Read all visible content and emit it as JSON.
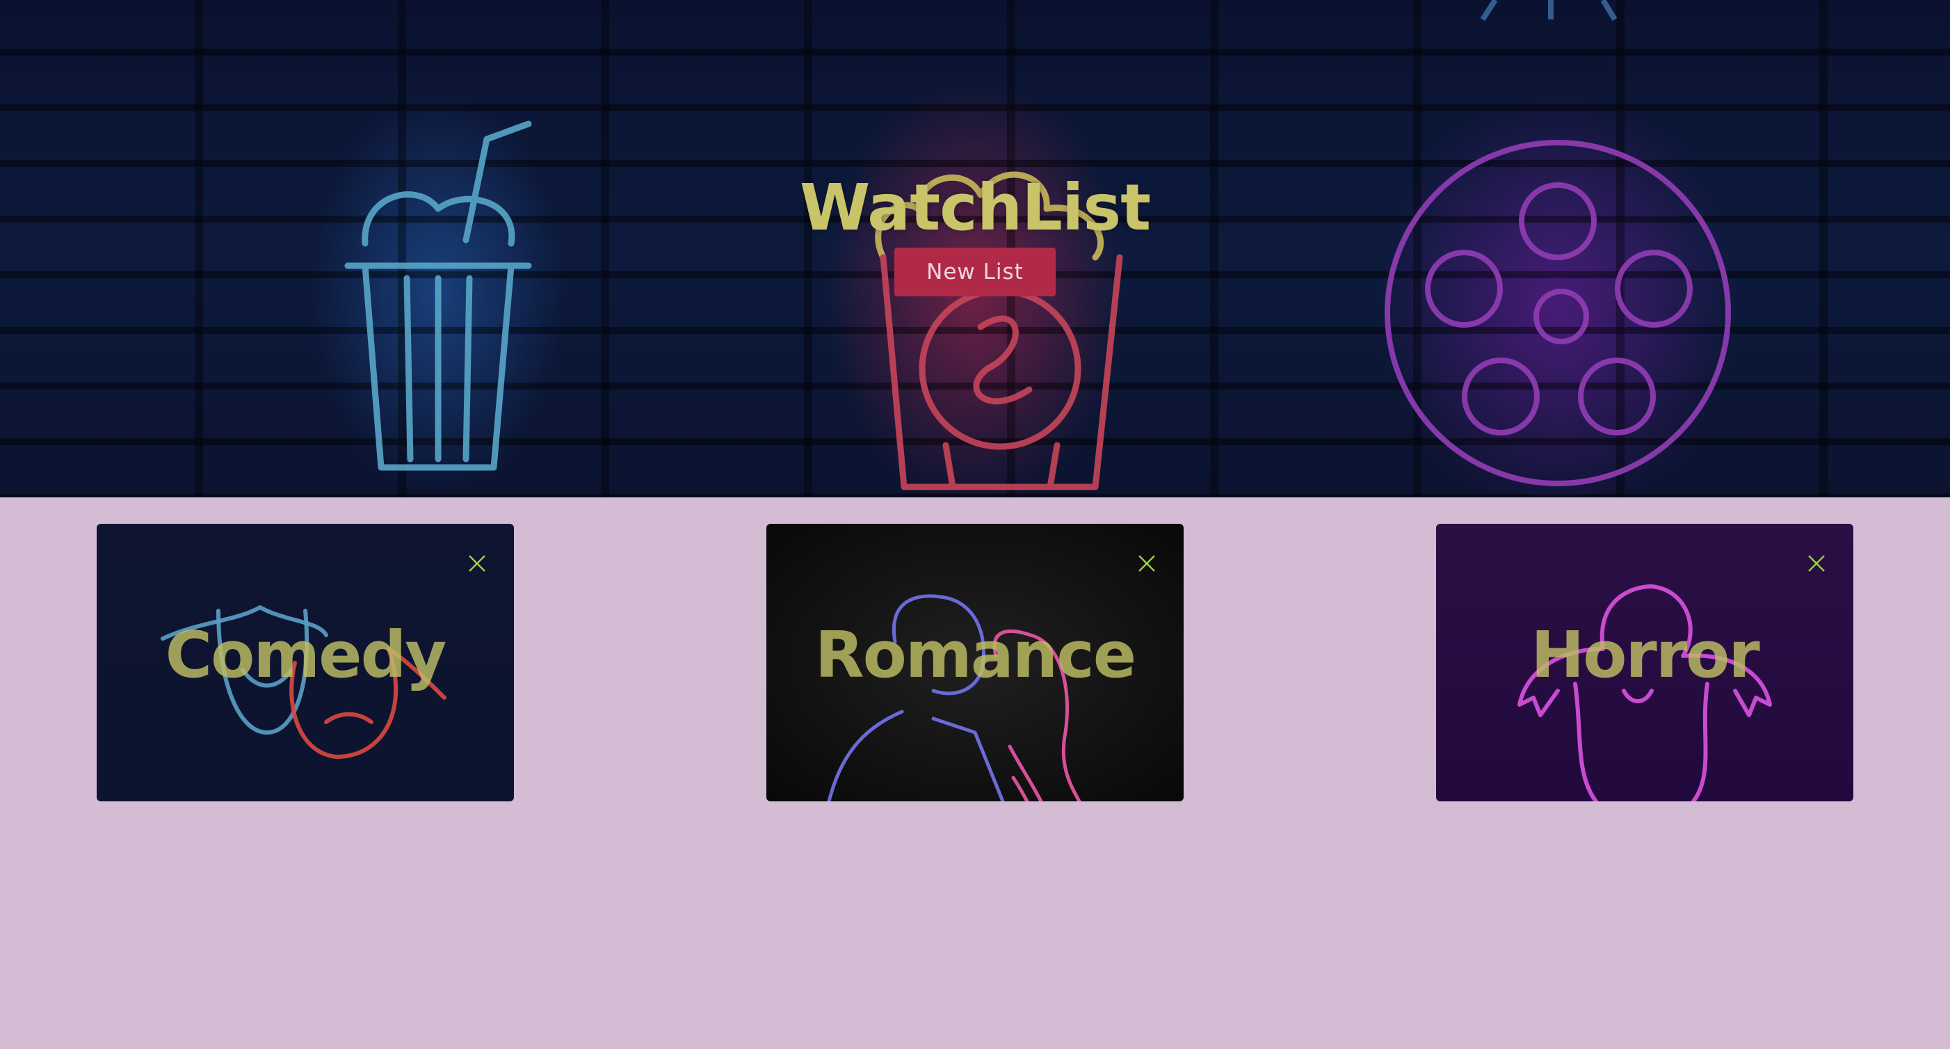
{
  "header": {
    "title": "WatchList",
    "new_list_label": "New List"
  },
  "lists": [
    {
      "title": "Comedy",
      "close_icon": "close-icon"
    },
    {
      "title": "Romance",
      "close_icon": "close-icon"
    },
    {
      "title": "Horror",
      "close_icon": "close-icon"
    }
  ],
  "colors": {
    "page_background": "#d4bcd5",
    "title_color": "#c9c36a",
    "button_background": "#b02a47",
    "close_icon_color": "#9ccc4a"
  },
  "icons": {
    "hero_left": "drink-cup-icon",
    "hero_center": "popcorn-icon",
    "hero_right": "film-reel-icon"
  }
}
